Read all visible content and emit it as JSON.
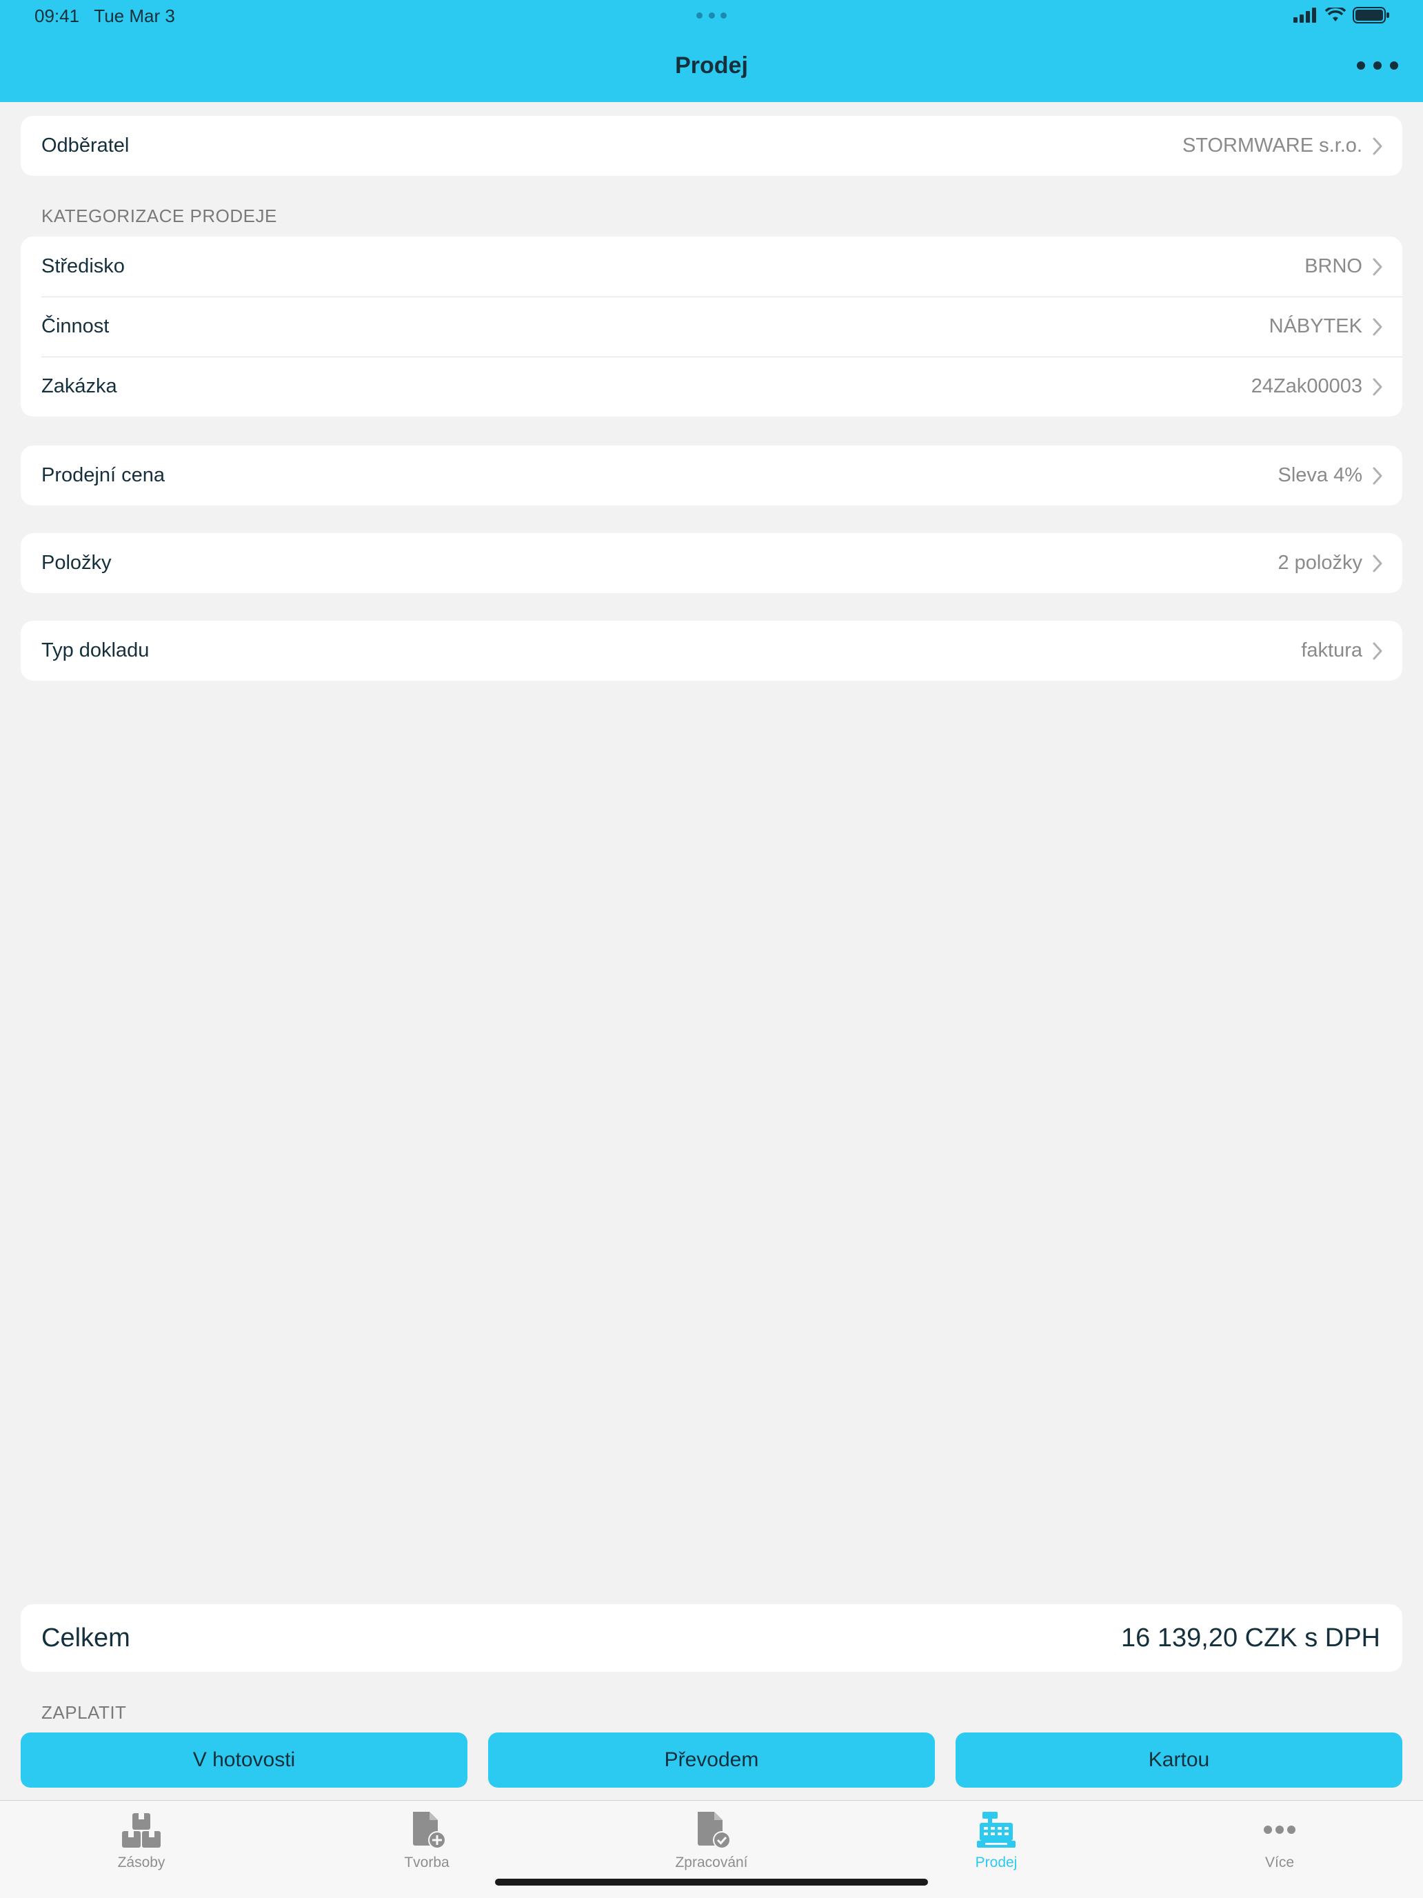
{
  "status_bar": {
    "time": "09:41",
    "date": "Tue Mar 3"
  },
  "nav": {
    "title": "Prodej"
  },
  "customer": {
    "label": "Odběratel",
    "value": "STORMWARE s.r.o."
  },
  "categorization": {
    "section_label": "KATEGORIZACE PRODEJE",
    "rows": [
      {
        "label": "Středisko",
        "value": "BRNO"
      },
      {
        "label": "Činnost",
        "value": "NÁBYTEK"
      },
      {
        "label": "Zakázka",
        "value": "24Zak00003"
      }
    ]
  },
  "price": {
    "label": "Prodejní cena",
    "value": "Sleva 4%"
  },
  "items": {
    "label": "Položky",
    "value": "2 položky"
  },
  "doc_type": {
    "label": "Typ dokladu",
    "value": "faktura"
  },
  "total": {
    "label": "Celkem",
    "value": "16 139,20 CZK s DPH"
  },
  "pay": {
    "section_label": "ZAPLATIT",
    "cash": "V hotovosti",
    "transfer": "Převodem",
    "card": "Kartou"
  },
  "tabs": [
    {
      "label": "Zásoby",
      "icon": "boxes-icon"
    },
    {
      "label": "Tvorba",
      "icon": "document-add-icon"
    },
    {
      "label": "Zpracování",
      "icon": "document-check-icon"
    },
    {
      "label": "Prodej",
      "icon": "cash-register-icon",
      "active": true
    },
    {
      "label": "Více",
      "icon": "more-icon"
    }
  ],
  "colors": {
    "accent": "#2ccaf0",
    "text": "#14303c",
    "muted": "#8a8a8a",
    "background": "#f2f2f2"
  }
}
